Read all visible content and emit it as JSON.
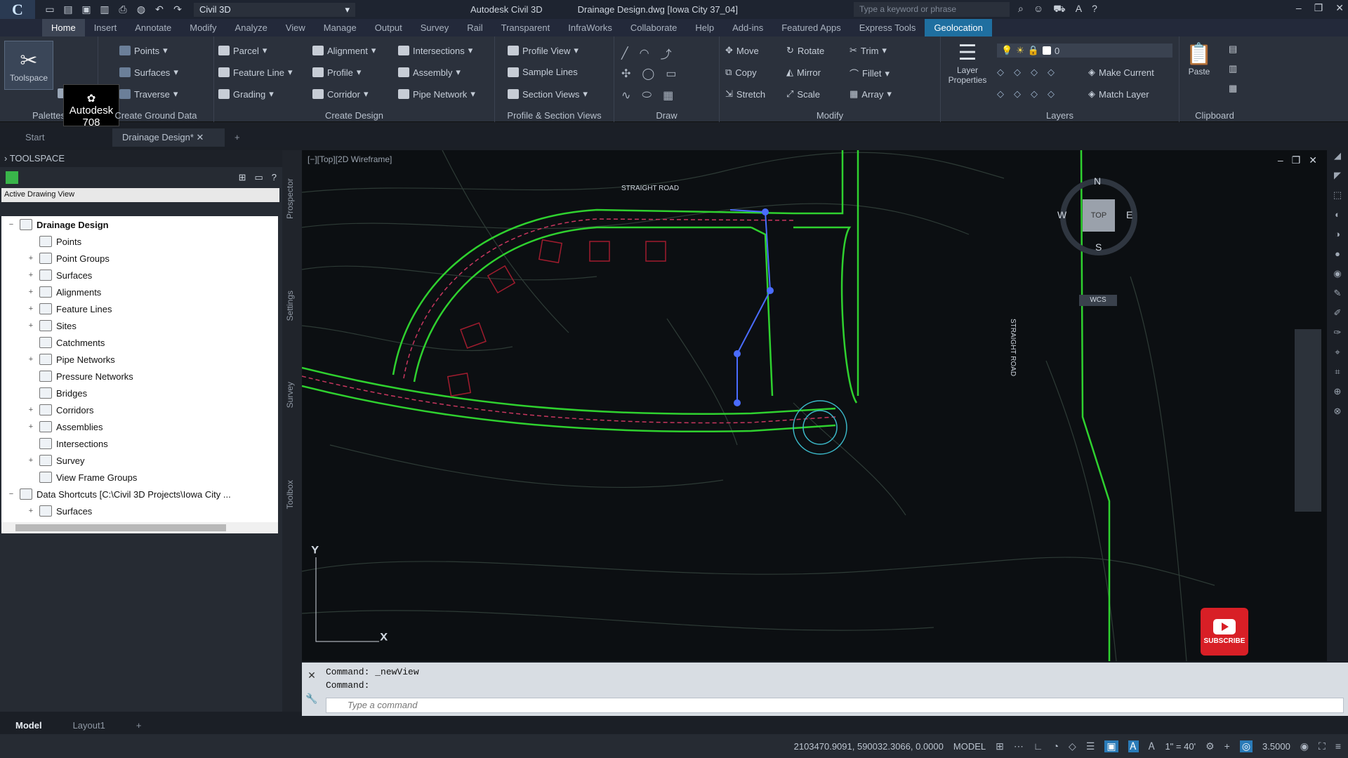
{
  "titlebar": {
    "logo": "C",
    "workspace": "Civil 3D",
    "app_name": "Autodesk Civil 3D",
    "doc_name": "Drainage Design.dwg [Iowa City 37_04]",
    "search_placeholder": "Type a keyword or phrase"
  },
  "menu": {
    "tabs": [
      "Home",
      "Insert",
      "Annotate",
      "Modify",
      "Analyze",
      "View",
      "Manage",
      "Output",
      "Survey",
      "Rail",
      "Transparent",
      "InfraWorks",
      "Collaborate",
      "Help",
      "Add-ins",
      "Featured Apps",
      "Express Tools",
      "Geolocation"
    ],
    "active": "Home"
  },
  "ribbon": {
    "toolspace_label": "Toolspace",
    "tooltip": "Autodesk 708",
    "palettes_title": "Palettes",
    "ground": {
      "title": "Create Ground Data",
      "items": [
        "Points",
        "Surfaces",
        "Traverse"
      ]
    },
    "design": {
      "title": "Create Design",
      "items": [
        "Parcel",
        "Feature Line",
        "Grading",
        "Alignment",
        "Profile",
        "Corridor",
        "Intersections",
        "Assembly",
        "Pipe Network"
      ]
    },
    "profile": {
      "title": "Profile & Section Views",
      "items": [
        "Profile View",
        "Sample Lines",
        "Section Views"
      ]
    },
    "draw": {
      "title": "Draw"
    },
    "modify": {
      "title": "Modify",
      "items": [
        "Move",
        "Rotate",
        "Trim",
        "Copy",
        "Mirror",
        "Fillet",
        "Stretch",
        "Scale",
        "Array"
      ]
    },
    "layers": {
      "title": "Layers",
      "layer_props": "Layer Properties",
      "current_layer": "0",
      "items": [
        "Make Current",
        "Match Layer"
      ]
    },
    "clipboard": {
      "title": "Clipboard",
      "paste": "Paste"
    }
  },
  "doctabs": {
    "start": "Start",
    "active": "Drainage Design*"
  },
  "toolspace": {
    "header": "TOOLSPACE",
    "view_selector": "Active Drawing View",
    "tree": [
      {
        "label": "Drainage Design",
        "level": 0,
        "exp": "−",
        "bold": true
      },
      {
        "label": "Points",
        "level": 1,
        "exp": ""
      },
      {
        "label": "Point Groups",
        "level": 1,
        "exp": "+"
      },
      {
        "label": "Surfaces",
        "level": 1,
        "exp": "+"
      },
      {
        "label": "Alignments",
        "level": 1,
        "exp": "+"
      },
      {
        "label": "Feature Lines",
        "level": 1,
        "exp": "+"
      },
      {
        "label": "Sites",
        "level": 1,
        "exp": "+"
      },
      {
        "label": "Catchments",
        "level": 1,
        "exp": ""
      },
      {
        "label": "Pipe Networks",
        "level": 1,
        "exp": "+"
      },
      {
        "label": "Pressure Networks",
        "level": 1,
        "exp": ""
      },
      {
        "label": "Bridges",
        "level": 1,
        "exp": ""
      },
      {
        "label": "Corridors",
        "level": 1,
        "exp": "+"
      },
      {
        "label": "Assemblies",
        "level": 1,
        "exp": "+"
      },
      {
        "label": "Intersections",
        "level": 1,
        "exp": ""
      },
      {
        "label": "Survey",
        "level": 1,
        "exp": "+"
      },
      {
        "label": "View Frame Groups",
        "level": 1,
        "exp": ""
      },
      {
        "label": "Data Shortcuts [C:\\Civil 3D Projects\\Iowa City ...",
        "level": 0,
        "exp": "−"
      },
      {
        "label": "Surfaces",
        "level": 1,
        "exp": "+"
      }
    ],
    "vtabs": [
      "Prospector",
      "Settings",
      "Survey",
      "Toolbox"
    ]
  },
  "viewport": {
    "label": "[−][Top][2D Wireframe]",
    "compass": {
      "n": "N",
      "s": "S",
      "e": "E",
      "w": "W",
      "top": "TOP"
    },
    "wcs": "WCS",
    "street_label": "STRAIGHT ROAD",
    "north_label": "STRAIGHT ROAD"
  },
  "command": {
    "history": [
      "Command: _newView",
      "Command:"
    ],
    "placeholder": "Type a command"
  },
  "layouts": {
    "tabs": [
      "Model",
      "Layout1"
    ],
    "active": "Model"
  },
  "status": {
    "coords": "2103470.9091, 590032.3066, 0.0000",
    "model": "MODEL",
    "scale": "1\" = 40'",
    "zoom": "3.5000"
  },
  "subscribe": "SUBSCRIBE"
}
